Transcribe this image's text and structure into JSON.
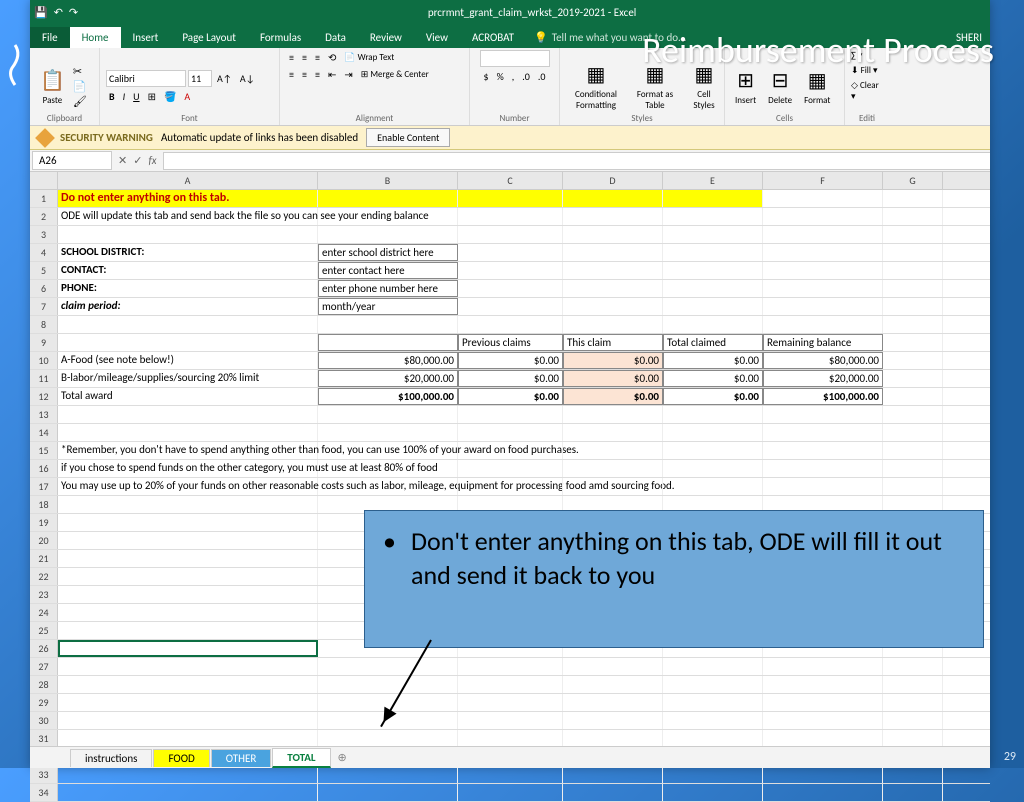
{
  "titlebar": {
    "title": "prcrmnt_grant_claim_wrkst_2019-2021 - Excel"
  },
  "tabs": {
    "file": "File",
    "home": "Home",
    "insert": "Insert",
    "pagelayout": "Page Layout",
    "formulas": "Formulas",
    "data": "Data",
    "review": "Review",
    "view": "View",
    "acrobat": "ACROBAT",
    "tell": "Tell me what you want to do...",
    "user": "SHERI"
  },
  "ribbon": {
    "paste": "Paste",
    "clipboard": "Clipboard",
    "font": "Font",
    "fontname": "Calibri",
    "fontsize": "11",
    "alignment": "Alignment",
    "wrap": "Wrap Text",
    "merge": "Merge & Center",
    "number": "Number",
    "styles": "Styles",
    "cond": "Conditional Formatting",
    "fmttable": "Format as Table",
    "cellstyles": "Cell Styles",
    "cells": "Cells",
    "insert": "Insert",
    "delete": "Delete",
    "format": "Format",
    "editing": "Editi",
    "fill": "Fill",
    "clear": "Clear"
  },
  "warning": {
    "label": "SECURITY WARNING",
    "text": "Automatic update of links has been disabled",
    "button": "Enable Content"
  },
  "namebox": "A26",
  "columns": [
    "A",
    "B",
    "C",
    "D",
    "E",
    "F",
    "G"
  ],
  "rows": {
    "r1": {
      "a": "Do not enter anything on this tab."
    },
    "r2": {
      "a": "ODE will update this tab and send back the file so you can see your ending balance"
    },
    "r4": {
      "a": "SCHOOL DISTRICT:",
      "b": "enter school district here"
    },
    "r5": {
      "a": "CONTACT:",
      "b": "enter contact here"
    },
    "r6": {
      "a": "PHONE:",
      "b": "enter phone number here"
    },
    "r7": {
      "a": "claim period:",
      "b": "month/year"
    },
    "r9": {
      "c": "Previous claims",
      "d": "This claim",
      "e": "Total claimed",
      "f": "Remaining balance"
    },
    "r10": {
      "a": "A-Food (see note below!)",
      "b": "$80,000.00",
      "c": "$0.00",
      "d": "$0.00",
      "e": "$0.00",
      "f": "$80,000.00"
    },
    "r11": {
      "a": "B-labor/mileage/supplies/sourcing 20% limit",
      "b": "$20,000.00",
      "c": "$0.00",
      "d": "$0.00",
      "e": "$0.00",
      "f": "$20,000.00"
    },
    "r12": {
      "a": "Total award",
      "b": "$100,000.00",
      "c": "$0.00",
      "d": "$0.00",
      "e": "$0.00",
      "f": "$100,000.00"
    },
    "r15": {
      "a": "*Remember, you don't have to spend anything other than food, you can use 100% of your award on food purchases."
    },
    "r16": {
      "a": "   if you chose to spend funds on the other category, you must use at least 80% of food"
    },
    "r17": {
      "a": "   You may use up to  20% of your funds on other reasonable costs such as labor, mileage, equipment for processing food amd sourcing food."
    }
  },
  "sheets": {
    "instructions": "instructions",
    "food": "FOOD",
    "other": "OTHER",
    "total": "TOTAL"
  },
  "overlay": {
    "title": "Reimbursement Process",
    "callout": "Don't enter anything on this tab, ODE will fill it out and send it back to you",
    "slidenum": "29"
  }
}
